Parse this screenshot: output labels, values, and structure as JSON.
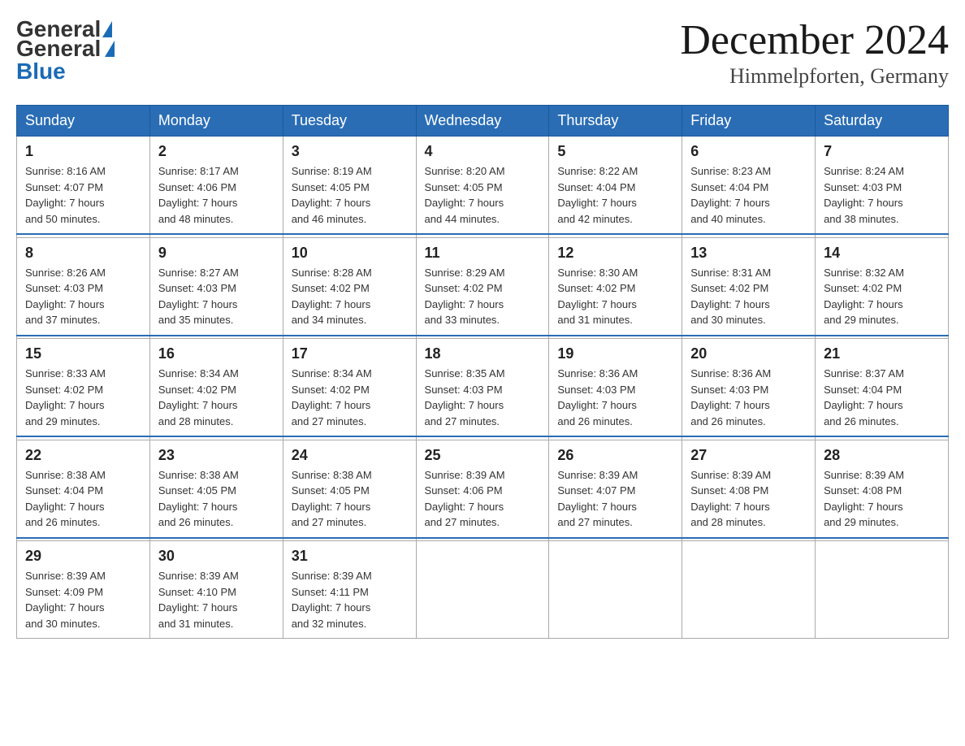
{
  "header": {
    "logo_general": "General",
    "logo_blue": "Blue",
    "month_title": "December 2024",
    "location": "Himmelpforten, Germany"
  },
  "days_of_week": [
    "Sunday",
    "Monday",
    "Tuesday",
    "Wednesday",
    "Thursday",
    "Friday",
    "Saturday"
  ],
  "weeks": [
    [
      {
        "day": "1",
        "sunrise": "8:16 AM",
        "sunset": "4:07 PM",
        "daylight": "7 hours and 50 minutes."
      },
      {
        "day": "2",
        "sunrise": "8:17 AM",
        "sunset": "4:06 PM",
        "daylight": "7 hours and 48 minutes."
      },
      {
        "day": "3",
        "sunrise": "8:19 AM",
        "sunset": "4:05 PM",
        "daylight": "7 hours and 46 minutes."
      },
      {
        "day": "4",
        "sunrise": "8:20 AM",
        "sunset": "4:05 PM",
        "daylight": "7 hours and 44 minutes."
      },
      {
        "day": "5",
        "sunrise": "8:22 AM",
        "sunset": "4:04 PM",
        "daylight": "7 hours and 42 minutes."
      },
      {
        "day": "6",
        "sunrise": "8:23 AM",
        "sunset": "4:04 PM",
        "daylight": "7 hours and 40 minutes."
      },
      {
        "day": "7",
        "sunrise": "8:24 AM",
        "sunset": "4:03 PM",
        "daylight": "7 hours and 38 minutes."
      }
    ],
    [
      {
        "day": "8",
        "sunrise": "8:26 AM",
        "sunset": "4:03 PM",
        "daylight": "7 hours and 37 minutes."
      },
      {
        "day": "9",
        "sunrise": "8:27 AM",
        "sunset": "4:03 PM",
        "daylight": "7 hours and 35 minutes."
      },
      {
        "day": "10",
        "sunrise": "8:28 AM",
        "sunset": "4:02 PM",
        "daylight": "7 hours and 34 minutes."
      },
      {
        "day": "11",
        "sunrise": "8:29 AM",
        "sunset": "4:02 PM",
        "daylight": "7 hours and 33 minutes."
      },
      {
        "day": "12",
        "sunrise": "8:30 AM",
        "sunset": "4:02 PM",
        "daylight": "7 hours and 31 minutes."
      },
      {
        "day": "13",
        "sunrise": "8:31 AM",
        "sunset": "4:02 PM",
        "daylight": "7 hours and 30 minutes."
      },
      {
        "day": "14",
        "sunrise": "8:32 AM",
        "sunset": "4:02 PM",
        "daylight": "7 hours and 29 minutes."
      }
    ],
    [
      {
        "day": "15",
        "sunrise": "8:33 AM",
        "sunset": "4:02 PM",
        "daylight": "7 hours and 29 minutes."
      },
      {
        "day": "16",
        "sunrise": "8:34 AM",
        "sunset": "4:02 PM",
        "daylight": "7 hours and 28 minutes."
      },
      {
        "day": "17",
        "sunrise": "8:34 AM",
        "sunset": "4:02 PM",
        "daylight": "7 hours and 27 minutes."
      },
      {
        "day": "18",
        "sunrise": "8:35 AM",
        "sunset": "4:03 PM",
        "daylight": "7 hours and 27 minutes."
      },
      {
        "day": "19",
        "sunrise": "8:36 AM",
        "sunset": "4:03 PM",
        "daylight": "7 hours and 26 minutes."
      },
      {
        "day": "20",
        "sunrise": "8:36 AM",
        "sunset": "4:03 PM",
        "daylight": "7 hours and 26 minutes."
      },
      {
        "day": "21",
        "sunrise": "8:37 AM",
        "sunset": "4:04 PM",
        "daylight": "7 hours and 26 minutes."
      }
    ],
    [
      {
        "day": "22",
        "sunrise": "8:38 AM",
        "sunset": "4:04 PM",
        "daylight": "7 hours and 26 minutes."
      },
      {
        "day": "23",
        "sunrise": "8:38 AM",
        "sunset": "4:05 PM",
        "daylight": "7 hours and 26 minutes."
      },
      {
        "day": "24",
        "sunrise": "8:38 AM",
        "sunset": "4:05 PM",
        "daylight": "7 hours and 27 minutes."
      },
      {
        "day": "25",
        "sunrise": "8:39 AM",
        "sunset": "4:06 PM",
        "daylight": "7 hours and 27 minutes."
      },
      {
        "day": "26",
        "sunrise": "8:39 AM",
        "sunset": "4:07 PM",
        "daylight": "7 hours and 27 minutes."
      },
      {
        "day": "27",
        "sunrise": "8:39 AM",
        "sunset": "4:08 PM",
        "daylight": "7 hours and 28 minutes."
      },
      {
        "day": "28",
        "sunrise": "8:39 AM",
        "sunset": "4:08 PM",
        "daylight": "7 hours and 29 minutes."
      }
    ],
    [
      {
        "day": "29",
        "sunrise": "8:39 AM",
        "sunset": "4:09 PM",
        "daylight": "7 hours and 30 minutes."
      },
      {
        "day": "30",
        "sunrise": "8:39 AM",
        "sunset": "4:10 PM",
        "daylight": "7 hours and 31 minutes."
      },
      {
        "day": "31",
        "sunrise": "8:39 AM",
        "sunset": "4:11 PM",
        "daylight": "7 hours and 32 minutes."
      },
      null,
      null,
      null,
      null
    ]
  ],
  "labels": {
    "sunrise": "Sunrise:",
    "sunset": "Sunset:",
    "daylight": "Daylight:"
  }
}
